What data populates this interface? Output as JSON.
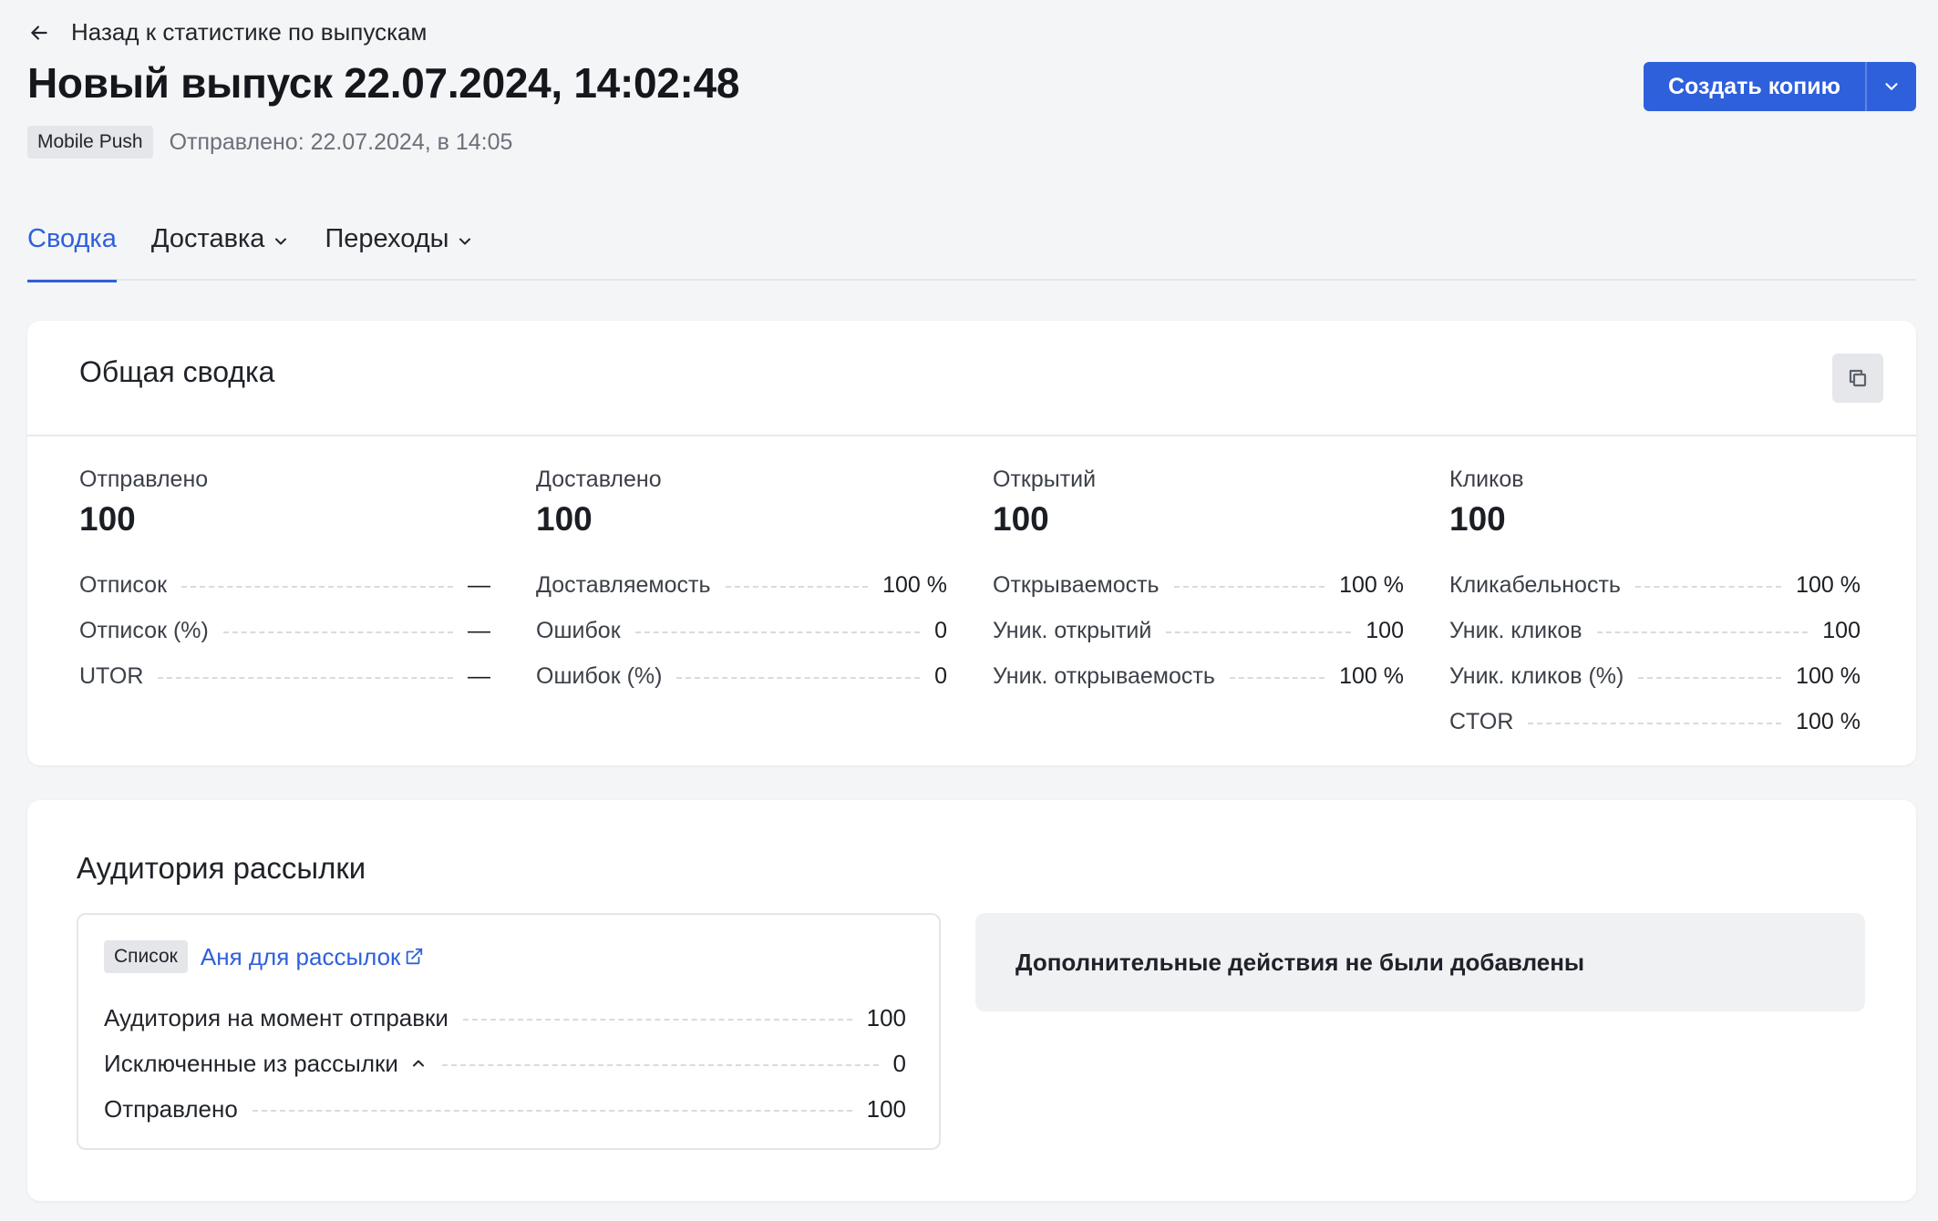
{
  "header": {
    "back_label": "Назад к статистике по выпускам",
    "title": "Новый выпуск 22.07.2024, 14:02:48",
    "channel_badge": "Mobile Push",
    "sent_info": "Отправлено: 22.07.2024, в 14:05",
    "copy_button": "Создать копию"
  },
  "tabs": [
    {
      "label": "Сводка",
      "active": true,
      "dropdown": false
    },
    {
      "label": "Доставка",
      "active": false,
      "dropdown": true
    },
    {
      "label": "Переходы",
      "active": false,
      "dropdown": true
    }
  ],
  "summary": {
    "title": "Общая сводка",
    "columns": [
      {
        "label": "Отправлено",
        "value": "100",
        "rows": [
          {
            "key": "Отписок",
            "value": "—"
          },
          {
            "key": "Отписок (%)",
            "value": "—"
          },
          {
            "key": "UTOR",
            "value": "—"
          }
        ]
      },
      {
        "label": "Доставлено",
        "value": "100",
        "rows": [
          {
            "key": "Доставляемость",
            "value": "100 %"
          },
          {
            "key": "Ошибок",
            "value": "0"
          },
          {
            "key": "Ошибок (%)",
            "value": "0"
          }
        ]
      },
      {
        "label": "Открытий",
        "value": "100",
        "rows": [
          {
            "key": "Открываемость",
            "value": "100 %"
          },
          {
            "key": "Уник. открытий",
            "value": "100"
          },
          {
            "key": "Уник. открываемость",
            "value": "100 %"
          }
        ]
      },
      {
        "label": "Кликов",
        "value": "100",
        "rows": [
          {
            "key": "Кликабельность",
            "value": "100 %"
          },
          {
            "key": "Уник. кликов",
            "value": "100"
          },
          {
            "key": "Уник. кликов (%)",
            "value": "100 %"
          },
          {
            "key": "CTOR",
            "value": "100 %"
          }
        ]
      }
    ]
  },
  "audience": {
    "title": "Аудитория рассылки",
    "list_badge": "Список",
    "list_name": "Аня для рассылок",
    "rows": [
      {
        "key": "Аудитория на момент отправки",
        "value": "100"
      },
      {
        "key": "Исключенные из рассылки",
        "value": "0"
      },
      {
        "key": "Отправлено",
        "value": "100"
      }
    ],
    "extra_actions": "Дополнительные действия не были добавлены"
  },
  "colors": {
    "accent": "#2f60dc",
    "background": "#f4f5f7"
  },
  "icons": [
    "arrow-left-icon",
    "chevron-down-icon",
    "copy-icon",
    "external-link-icon",
    "chevron-up-icon"
  ]
}
